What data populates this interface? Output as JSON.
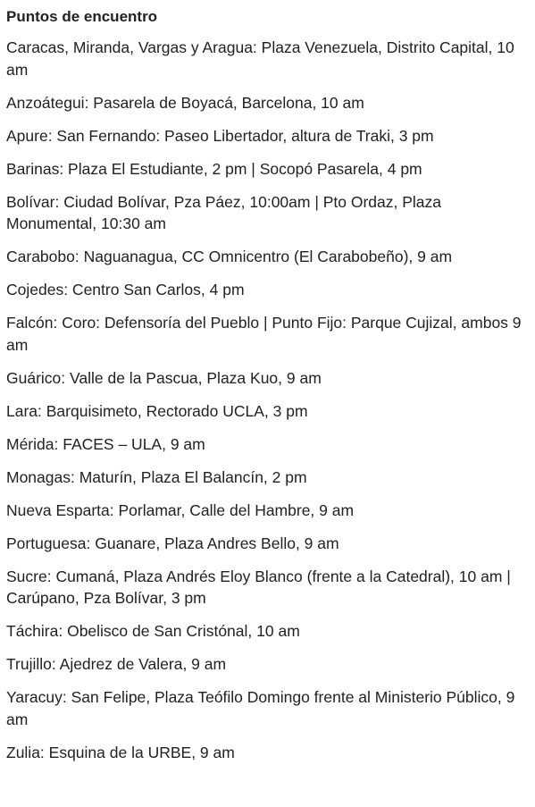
{
  "heading": "Puntos de encuentro",
  "entries": [
    "Caracas, Miranda, Vargas y Aragua: Plaza Venezuela, Distrito Capital, 10 am",
    "Anzoátegui: Pasarela de Boyacá, Barcelona, 10 am",
    "Apure: San Fernando: Paseo Libertador, altura de Traki, 3 pm",
    "Barinas: Plaza El Estudiante, 2 pm | Socopó Pasarela, 4 pm",
    "Bolívar: Ciudad Bolívar, Pza Páez, 10:00am | Pto Ordaz, Plaza Monumental, 10:30 am",
    "Carabobo: Naguanagua, CC Omnicentro (El Carabobeño), 9 am",
    "Cojedes: Centro San Carlos, 4 pm",
    "Falcón: Coro: Defensoría del Pueblo | Punto Fijo: Parque Cujizal, ambos 9 am",
    "Guárico: Valle de la Pascua, Plaza Kuo, 9 am",
    "Lara: Barquisimeto, Rectorado UCLA, 3 pm",
    "Mérida: FACES – ULA, 9 am",
    "Monagas: Maturín, Plaza El Balancín, 2 pm",
    "Nueva Esparta: Porlamar, Calle del Hambre, 9 am",
    "Portuguesa: Guanare, Plaza Andres Bello, 9 am",
    "Sucre: Cumaná, Plaza Andrés Eloy Blanco (frente a la Catedral), 10 am | Carúpano, Pza Bolívar, 3 pm",
    "Táchira: Obelisco de San Cristónal, 10 am",
    "Trujillo: Ajedrez de Valera, 9 am",
    "Yaracuy: San Felipe, Plaza Teófilo Domingo frente al Ministerio Público, 9 am",
    "Zulia: Esquina de la URBE, 9 am"
  ]
}
